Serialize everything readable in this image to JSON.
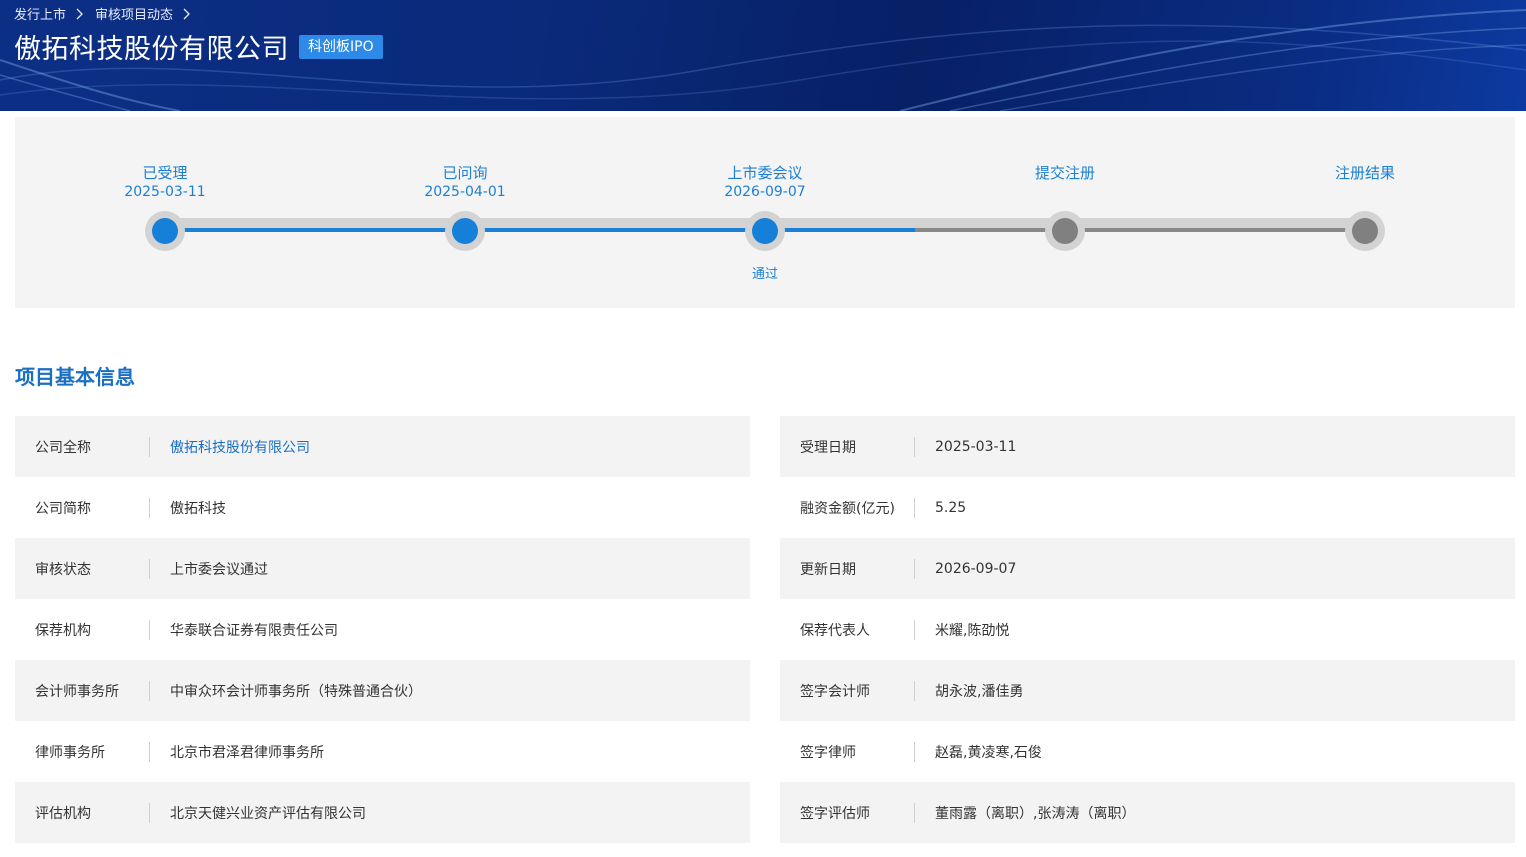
{
  "breadcrumb": {
    "items": [
      "发行上市",
      "审核项目动态"
    ]
  },
  "header": {
    "company_title": "傲拓科技股份有限公司",
    "board_tag": "科创板IPO"
  },
  "progress": {
    "steps": [
      {
        "label": "已受理",
        "date": "2025-03-11",
        "status": "done",
        "result": ""
      },
      {
        "label": "已问询",
        "date": "2025-04-01",
        "status": "done",
        "result": ""
      },
      {
        "label": "上市委会议",
        "date": "2026-09-07",
        "status": "done",
        "result": "通过"
      },
      {
        "label": "提交注册",
        "date": "",
        "status": "pending",
        "result": ""
      },
      {
        "label": "注册结果",
        "date": "",
        "status": "pending",
        "result": ""
      }
    ],
    "colors": {
      "done": "#1680d9",
      "pending": "#808080"
    }
  },
  "section": {
    "title": "项目基本信息"
  },
  "info": {
    "left": [
      {
        "label": "公司全称",
        "value": "傲拓科技股份有限公司"
      },
      {
        "label": "公司简称",
        "value": "傲拓科技"
      },
      {
        "label": "审核状态",
        "value": "上市委会议通过"
      },
      {
        "label": "保荐机构",
        "value": "华泰联合证券有限责任公司"
      },
      {
        "label": "会计师事务所",
        "value": "中审众环会计师事务所（特殊普通合伙）"
      },
      {
        "label": "律师事务所",
        "value": "北京市君泽君律师事务所"
      },
      {
        "label": "评估机构",
        "value": "北京天健兴业资产评估有限公司"
      }
    ],
    "right": [
      {
        "label": "受理日期",
        "value": "2025-03-11"
      },
      {
        "label": "融资金额(亿元)",
        "value": "5.25"
      },
      {
        "label": "更新日期",
        "value": "2026-09-07"
      },
      {
        "label": "保荐代表人",
        "value": "米耀,陈劭悦"
      },
      {
        "label": "签字会计师",
        "value": "胡永波,潘佳勇"
      },
      {
        "label": "签字律师",
        "value": "赵磊,黄凌寒,石俊"
      },
      {
        "label": "签字评估师",
        "value": "董雨露（离职）,张涛涛（离职）"
      }
    ]
  }
}
